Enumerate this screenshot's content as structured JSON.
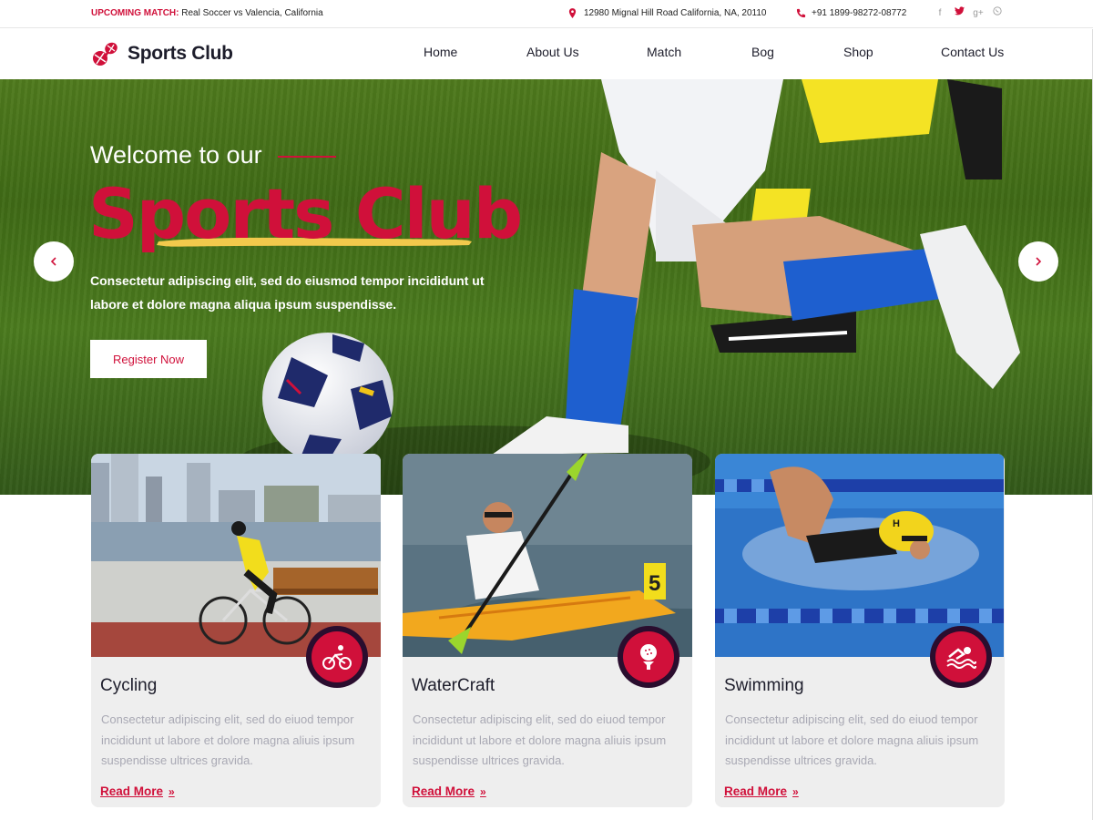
{
  "topbar": {
    "match_label": "UPCOMING MATCH:",
    "match_text": "Real Soccer vs Valencia, California",
    "address": "12980 Mignal Hill Road California, NA, 20110",
    "phone": "+91 1899-98272-08772",
    "socials": [
      "facebook-icon",
      "twitter-icon",
      "google-plus-icon",
      "whatsapp-icon"
    ]
  },
  "header": {
    "logo_text": "Sports Club",
    "nav": [
      "Home",
      "About Us",
      "Match",
      "Bog",
      "Shop",
      "Contact Us"
    ]
  },
  "hero": {
    "welcome": "Welcome to our",
    "title": "Sports Club",
    "description": "Consectetur adipiscing elit, sed do eiusmod tempor incididunt ut labore et dolore magna aliqua ipsum suspendisse.",
    "button": "Register Now"
  },
  "cards": [
    {
      "title": "Cycling",
      "description": "Consectetur adipiscing elit, sed do eiuod tempor incididunt ut labore et dolore magna aliuis ipsum suspendisse ultrices gravida.",
      "link": "Read More",
      "icon": "cycling-icon"
    },
    {
      "title": "WaterCraft",
      "description": "Consectetur adipiscing elit, sed do eiuod tempor incididunt ut labore et dolore magna aliuis ipsum suspendisse ultrices gravida.",
      "link": "Read More",
      "icon": "golf-icon"
    },
    {
      "title": "Swimming",
      "description": "Consectetur adipiscing elit, sed do eiuod tempor incididunt ut labore et dolore magna aliuis ipsum suspendisse ultrices gravida.",
      "link": "Read More",
      "icon": "swimming-icon"
    }
  ],
  "colors": {
    "accent": "#d0103a",
    "dark": "#2a0d2e",
    "brush": "#f2c94c"
  }
}
